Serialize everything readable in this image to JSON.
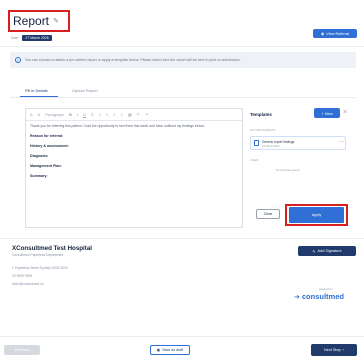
{
  "header": {
    "title": "Report",
    "edit_icon": "pencil-icon",
    "meta_prefix": "Date",
    "date": "27 March 2026",
    "view_referral_label": "View Referral"
  },
  "info_banner": {
    "icon": "info-icon",
    "text": "You can choose to attach a pre-written report or apply a template below. Please select who the report will be sent to prior to submission."
  },
  "tabs": [
    {
      "label": "Fill in Details",
      "active": true
    },
    {
      "label": "Upload Report",
      "active": false
    }
  ],
  "editor": {
    "toolbar": [
      "A",
      "A",
      "Paragraph",
      "B",
      "I",
      "U",
      "S",
      "≡",
      "≡",
      "≡",
      "≡",
      "▦",
      "↶",
      "↷"
    ],
    "intro": "Thank you for referring this patient. I had the opportunity to see them this week and have outlined my findings below:",
    "fields": [
      "Reason for referral:",
      "History & assessment:",
      "Diagnosis:",
      "Management Plan:",
      "Summary:"
    ]
  },
  "templates": {
    "title": "Templates",
    "new_label": "+ New",
    "section_established": "ESTABLISHMENT",
    "card_name": "Generic report findings",
    "card_sub": "27 March 2026",
    "section_user": "USER",
    "none_text": "No template saved",
    "clear_label": "Clear",
    "apply_label": "Apply"
  },
  "footer": {
    "hospital_name": "XConsultmed Test Hospital",
    "department": "Consultmed Paperless Department",
    "address": "1 Paperless Street Sydney NSW 2000",
    "phone": "02 9999 9999",
    "email": "hello@consultmed.co",
    "add_signature_label": "Add Signature",
    "powered_by": "powered by",
    "brand": "consultmed"
  },
  "actions": {
    "previous_label": "Previous",
    "save_draft_label": "Save as draft",
    "next_step_label": "Next Step"
  },
  "colors": {
    "primary": "#2f6fd6",
    "navy": "#1f3a6b",
    "highlight": "#d62020"
  }
}
